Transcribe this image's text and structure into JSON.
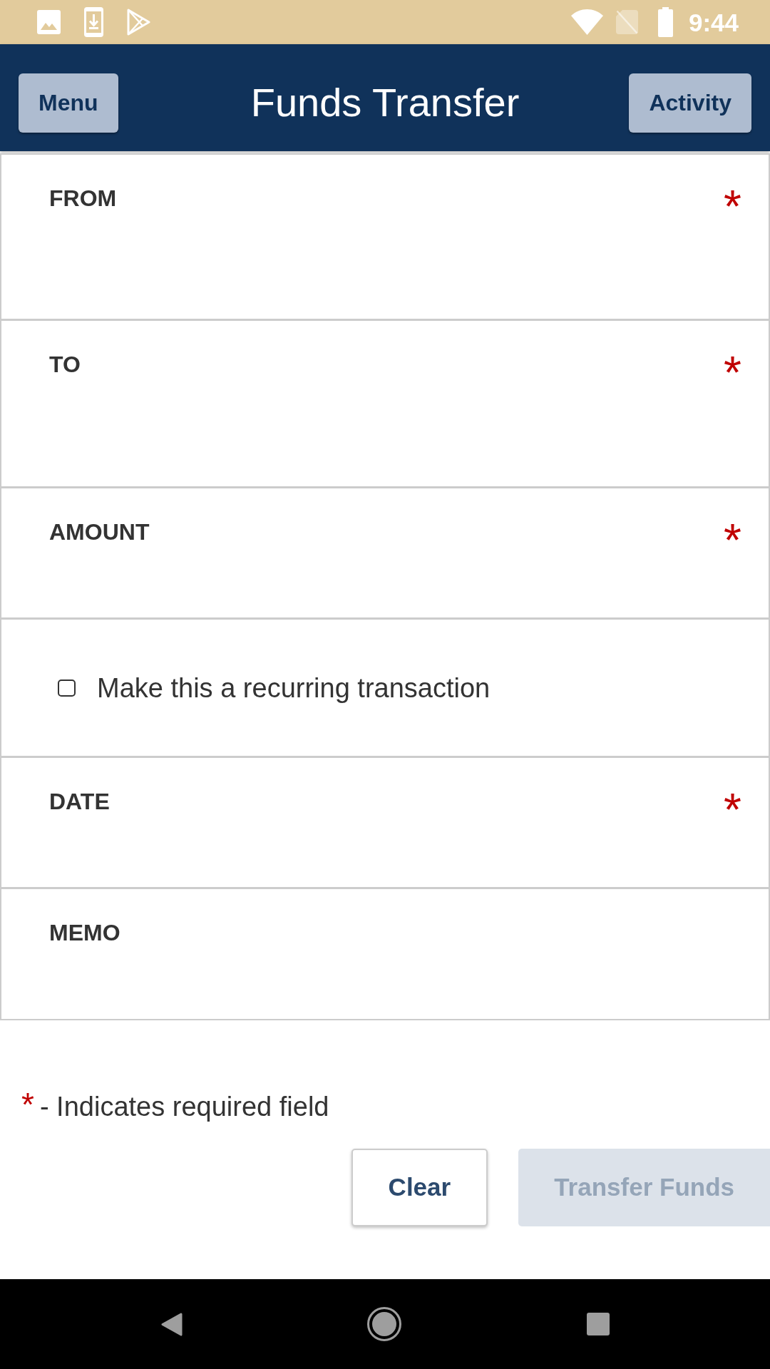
{
  "status_bar": {
    "time": "9:44"
  },
  "header": {
    "title": "Funds Transfer",
    "left_button": {
      "label": "Menu"
    },
    "right_button": {
      "label": "Activity"
    }
  },
  "form": {
    "sections": [
      {
        "kind": "select",
        "label": "FROM",
        "required_mark": "*"
      },
      {
        "kind": "select",
        "label": "TO",
        "required_mark": "*"
      },
      {
        "kind": "input",
        "label": "AMOUNT",
        "required_mark": "*"
      },
      {
        "kind": "checkbox",
        "label": "Make this a recurring transaction",
        "checked": false
      },
      {
        "kind": "input",
        "label": "DATE",
        "required_mark": "*"
      },
      {
        "kind": "input",
        "label": "MEMO"
      }
    ]
  },
  "required_note": {
    "mark": "*",
    "text": "- Indicates required field"
  },
  "buttons": [
    {
      "label": "Clear",
      "disabled": false
    },
    {
      "label": "Transfer Funds",
      "disabled": true
    }
  ]
}
